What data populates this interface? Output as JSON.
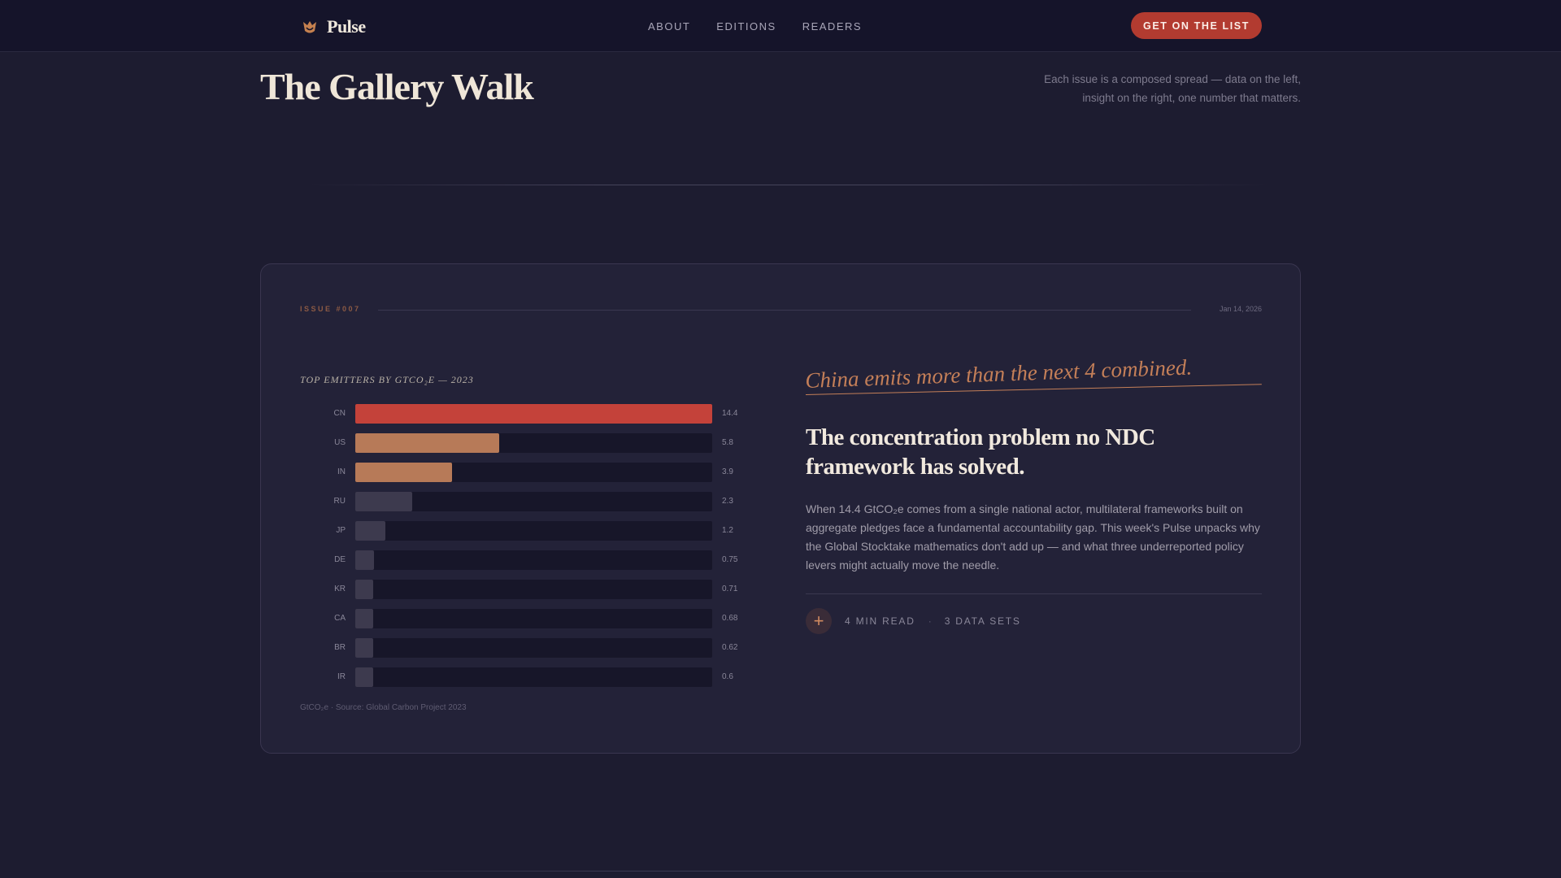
{
  "nav": {
    "brand": "Pulse",
    "links": [
      "ABOUT",
      "EDITIONS",
      "READERS"
    ],
    "cta": "GET ON THE LIST"
  },
  "header": {
    "title": "The Gallery Walk",
    "description": "Each issue is a composed spread — data on the left, insight on the right, one number that matters."
  },
  "card": {
    "issue": "ISSUE #007",
    "date": "Jan 14, 2026",
    "callout": "China emits more than the next 4 combined.",
    "headline": "The concentration problem no NDC framework has solved.",
    "body": "When 14.4 GtCO₂e comes from a single national actor, multilateral frameworks built on aggregate pledges face a fundamental accountability gap. This week's Pulse unpacks why the Global Stocktake mathematics don't add up — and what three underreported policy levers might actually move the needle.",
    "read_time": "4 MIN READ",
    "separator": "·",
    "data_sets": "3 DATA SETS",
    "source": "GtCO₂e · Source: Global Carbon Project 2023"
  },
  "chart_data": {
    "type": "bar",
    "orientation": "horizontal",
    "title": "TOP EMITTERS BY GTCO₂E — 2023",
    "categories": [
      "CN",
      "US",
      "IN",
      "RU",
      "JP",
      "DE",
      "KR",
      "CA",
      "BR",
      "IR"
    ],
    "values": [
      14.4,
      5.8,
      3.9,
      2.3,
      1.2,
      0.75,
      0.71,
      0.68,
      0.62,
      0.6
    ],
    "value_labels": [
      "14.4",
      "5.8",
      "3.9",
      "2.3",
      "1.2",
      "0.75",
      "0.71",
      "0.68",
      "0.62",
      "0.6"
    ],
    "xlim": [
      0,
      14.4
    ],
    "colors": [
      "#c4423a",
      "#b77a58",
      "#b77a58",
      "#3d3a4e",
      "#3d3a4e",
      "#3d3a4e",
      "#3d3a4e",
      "#3d3a4e",
      "#3d3a4e",
      "#3d3a4e"
    ],
    "grid": false
  }
}
